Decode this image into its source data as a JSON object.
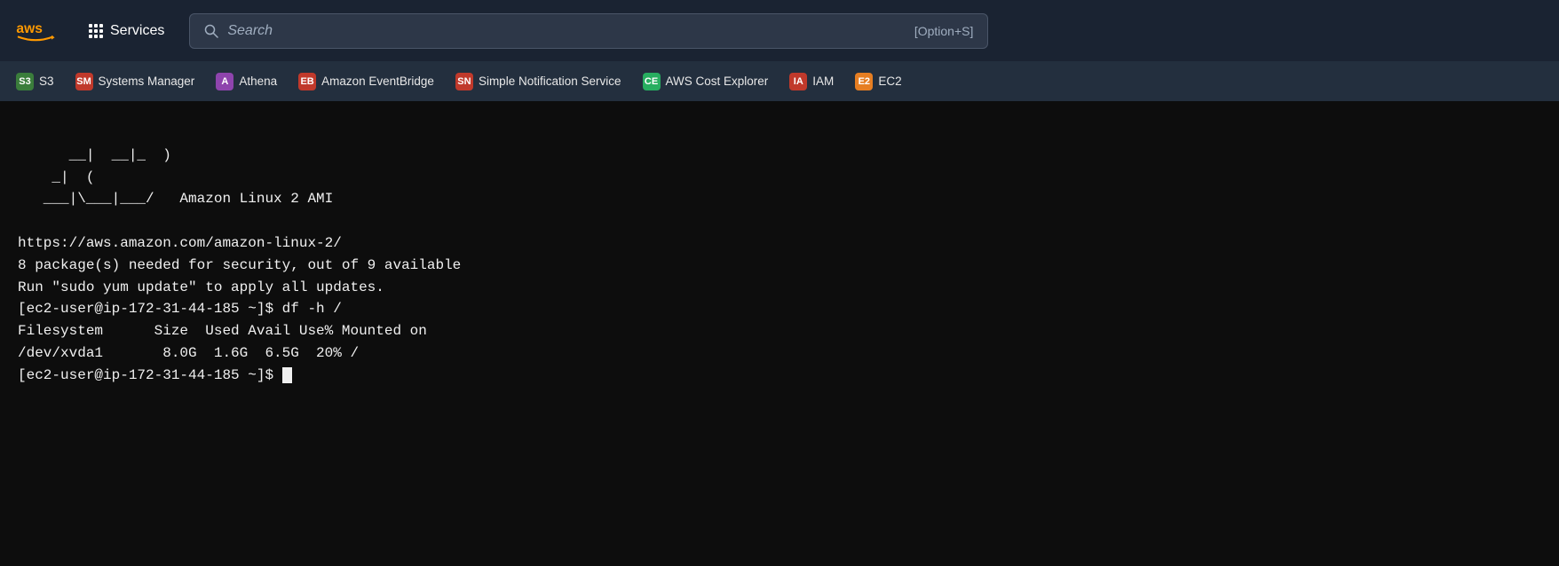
{
  "topnav": {
    "aws_logo_text": "aws",
    "services_label": "Services",
    "search_placeholder": "Search",
    "search_shortcut": "[Option+S]"
  },
  "bookmarks": [
    {
      "id": "s3",
      "label": "S3",
      "icon_class": "icon-s3",
      "icon_text": "S3"
    },
    {
      "id": "systems-manager",
      "label": "Systems Manager",
      "icon_class": "icon-sm",
      "icon_text": "SM"
    },
    {
      "id": "athena",
      "label": "Athena",
      "icon_class": "icon-athena",
      "icon_text": "A"
    },
    {
      "id": "amazon-eventbridge",
      "label": "Amazon EventBridge",
      "icon_class": "icon-eventbridge",
      "icon_text": "EB"
    },
    {
      "id": "simple-notification-service",
      "label": "Simple Notification Service",
      "icon_class": "icon-sns",
      "icon_text": "SN"
    },
    {
      "id": "aws-cost-explorer",
      "label": "AWS Cost Explorer",
      "icon_class": "icon-cost",
      "icon_text": "CE"
    },
    {
      "id": "iam",
      "label": "IAM",
      "icon_class": "icon-iam",
      "icon_text": "IA"
    },
    {
      "id": "ec2",
      "label": "EC2",
      "icon_class": "icon-ec2",
      "icon_text": "E2"
    }
  ],
  "terminal": {
    "ascii_art": "    __|  __|_  )\n    _|  (\n   ___|\\___|___/   Amazon Linux 2 AMI",
    "url": "https://aws.amazon.com/amazon-linux-2/",
    "security_msg": "8 package(s) needed for security, out of 9 available",
    "update_msg": "Run \"sudo yum update\" to apply all updates.",
    "command_df": "[ec2-user@ip-172-31-44-185 ~]$ df -h /",
    "fs_header": "Filesystem      Size  Used Avail Use% Mounted on",
    "fs_data": "/dev/xvda1       8.0G  1.6G  6.5G  20% /",
    "prompt_final": "[ec2-user@ip-172-31-44-185 ~]$ "
  }
}
